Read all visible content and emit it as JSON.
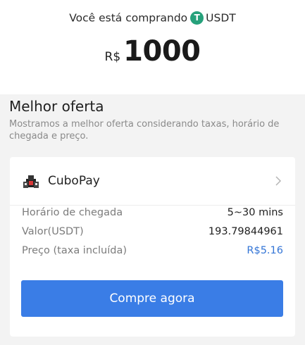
{
  "header": {
    "buying_text": "Você está comprando",
    "coin_symbol": "USDT",
    "coin_icon_glyph": "T",
    "coin_color": "#26a17b",
    "currency": "R$",
    "amount": "1000"
  },
  "offer": {
    "title": "Melhor oferta",
    "description": "Mostramos a melhor oferta considerando taxas, horário de chegada e preço."
  },
  "provider": {
    "name": "CuboPay",
    "logo_icon": "cubopay-logo-icon",
    "details": [
      {
        "label": "Horário de chegada",
        "value": "5~30 mins"
      },
      {
        "label": "Valor(USDT)",
        "value": "193.79844961"
      },
      {
        "label": "Preço (taxa incluída)",
        "value": "R$5.16"
      }
    ]
  },
  "actions": {
    "buy_label": "Compre agora",
    "button_color": "#3a7de6",
    "price_color": "#3475d6"
  }
}
